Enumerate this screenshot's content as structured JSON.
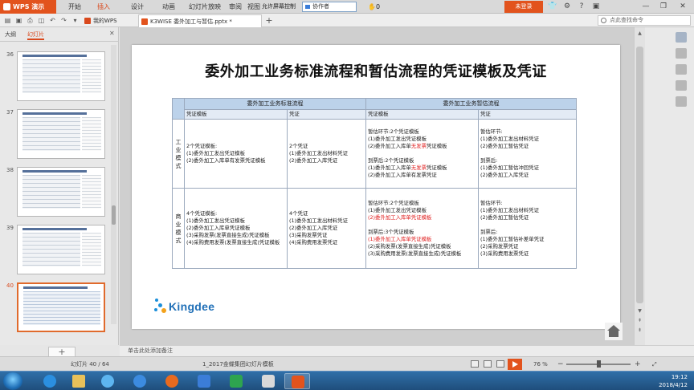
{
  "app": {
    "name": "WPS 演示"
  },
  "menu": {
    "items": [
      "开始",
      "插入",
      "设计",
      "动画",
      "幻灯片放映",
      "审阅",
      "视图"
    ],
    "active_index": 1
  },
  "collab": {
    "label": "允许屏幕控制",
    "selected": "协作者",
    "hand_count": "0"
  },
  "account": {
    "login_label": "未登录"
  },
  "tabs": {
    "home": "我的WPS",
    "doc": "K3WISE 委外加工与暂估.pptx *"
  },
  "search": {
    "placeholder": "点此查找命令"
  },
  "panel": {
    "tab_outline": "大纲",
    "tab_slides": "幻灯片"
  },
  "thumbnails": [
    {
      "num": "36",
      "selected": false
    },
    {
      "num": "37",
      "selected": false
    },
    {
      "num": "38",
      "selected": false
    },
    {
      "num": "39",
      "selected": false
    },
    {
      "num": "40",
      "selected": true
    }
  ],
  "slide": {
    "title": "委外加工业务标准流程和暂估流程的凭证模板及凭证",
    "logo_text": "Kingdee",
    "table": {
      "group_std": "委外加工业务标准流程",
      "group_est": "委外加工业务暂估流程",
      "col_tpl": "凭证模板",
      "col_vou": "凭证",
      "row1_label": "工业模式",
      "row2_label": "商业模式",
      "r1_std_tpl": [
        "2个凭证模板:",
        "(1)委外加工发出凭证模板",
        "(2)委外加工入库单有发票凭证模板"
      ],
      "r1_std_vou": [
        "2个凭证",
        "(1)委外加工发出材料凭证",
        "(2)委外加工入库凭证"
      ],
      "r1_est_tpl_a": [
        "暂估环节:2个凭证模板",
        "(1)委外加工发出凭证模板"
      ],
      "r1_est_tpl_a_red": [
        "(2)委外加工入库单",
        "无发票",
        "凭证模板"
      ],
      "r1_est_tpl_b": [
        "到票后:2个凭证模板"
      ],
      "r1_est_tpl_b_red": [
        "(1)委外加工入库单",
        "无发票",
        "凭证模板"
      ],
      "r1_est_tpl_c": [
        "(2)委外加工入库单有发票凭证"
      ],
      "r1_est_vou": [
        "暂估环节:",
        "(1)委外加工发出材料凭证",
        "(2)委外加工暂估凭证",
        "",
        "到票后:",
        "(1)委外加工暂估冲回凭证",
        "(2)委外加工入库凭证"
      ],
      "r2_std_tpl": [
        "4个凭证模板:",
        "(1)委外加工发出凭证模板",
        "(2)委外加工入库单凭证模板",
        "(3)采购发票(发票直接生成)凭证模板",
        "(4)采购费用发票(发票直接生成)凭证模板"
      ],
      "r2_std_vou": [
        "4个凭证",
        "(1)委外加工发出材料凭证",
        "(2)委外加工入库凭证",
        "(3)采购发票凭证",
        "(4)采购费用发票凭证"
      ],
      "r2_est_tpl_a": [
        "暂估环节:2个凭证模板",
        "(1)委外加工发出凭证模板"
      ],
      "r2_est_tpl_a_red": [
        "(2)委外加工入库单凭证模板"
      ],
      "r2_est_tpl_b": [
        "到票后:3个凭证模板"
      ],
      "r2_est_tpl_b_red": [
        "(1)委外加工入库单凭证模板"
      ],
      "r2_est_tpl_c": [
        "(2)采购发票(发票直接生成)凭证模板",
        "(3)采购费用发票(发票直接生成)凭证模板"
      ],
      "r2_est_vou": [
        "暂估环节:",
        "(1)委外加工发出材料凭证",
        "(2)委外加工暂估凭证",
        "",
        "到票后:",
        "(1)委外加工暂估补差单凭证",
        "(2)采购发票凭证",
        "(3)采购费用发票凭证"
      ]
    }
  },
  "notes": {
    "placeholder": "单击此处添加备注"
  },
  "status": {
    "slide_counter": "幻灯片 40 / 64",
    "template": "1_2017金蝶集团幻灯片模板",
    "zoom": "76 %"
  },
  "taskbar": {
    "time": "19:12",
    "date": "2018/4/12"
  }
}
